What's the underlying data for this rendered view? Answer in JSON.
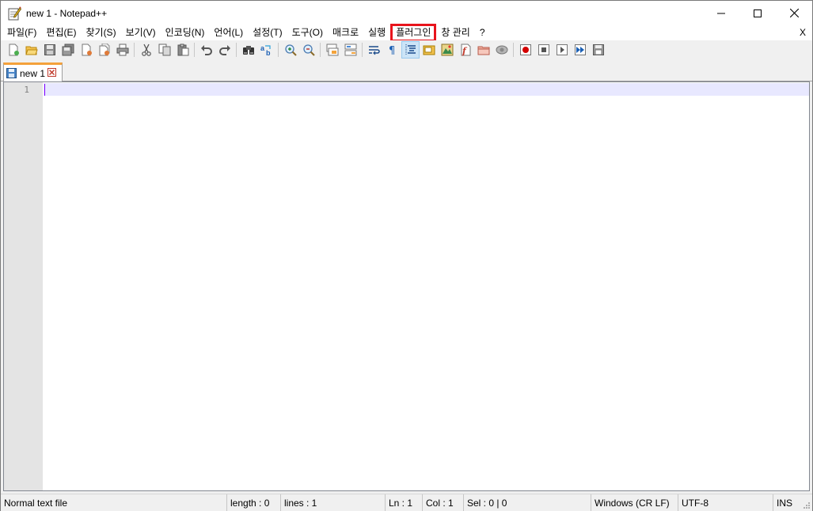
{
  "window": {
    "title": "new 1 - Notepad++"
  },
  "menubar": {
    "items": [
      "파일(F)",
      "편집(E)",
      "찾기(S)",
      "보기(V)",
      "인코딩(N)",
      "언어(L)",
      "설정(T)",
      "도구(O)",
      "매크로",
      "실행",
      "플러그인",
      "창 관리",
      "?"
    ],
    "highlighted_item": "플러그인",
    "highlight_color": "#e8141c",
    "close_label": "X"
  },
  "toolbar": {
    "buttons": [
      "new-file",
      "open-file",
      "save",
      "save-all",
      "close",
      "close-all",
      "print",
      "cut",
      "copy",
      "paste",
      "undo",
      "redo",
      "find",
      "replace",
      "zoom-in",
      "zoom-out",
      "sync-vertical",
      "sync-horizontal",
      "word-wrap",
      "show-all-chars",
      "indent-guide",
      "user-defined-language",
      "document-map",
      "function-list",
      "folder-as-workspace",
      "monitoring",
      "record-macro",
      "stop-macro",
      "play-macro",
      "play-macro-multiple",
      "save-macro"
    ],
    "active_button": "indent-guide"
  },
  "tabs": [
    {
      "label": "new 1",
      "active": true
    }
  ],
  "editor": {
    "line_numbers": [
      "1"
    ],
    "current_line_color": "#e8e8ff",
    "caret_color": "#8000ff"
  },
  "statusbar": {
    "file_type": "Normal text file",
    "length": "length : 0",
    "lines": "lines : 1",
    "ln": "Ln : 1",
    "col": "Col : 1",
    "sel": "Sel : 0 | 0",
    "eol": "Windows (CR LF)",
    "encoding": "UTF-8",
    "mode": "INS"
  }
}
